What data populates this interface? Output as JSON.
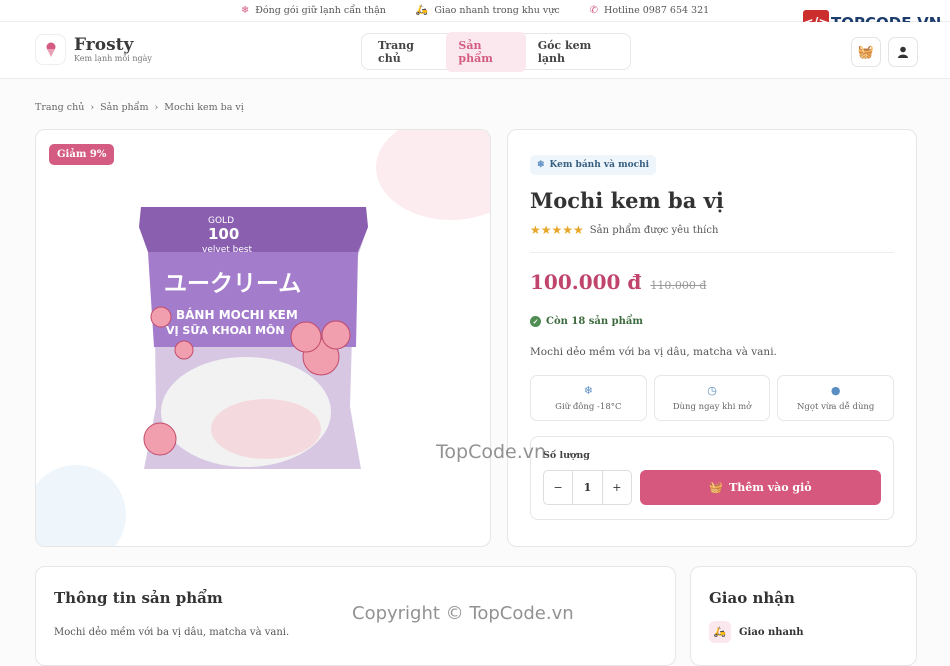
{
  "topbar": {
    "item1": "Đóng gói giữ lạnh cẩn thận",
    "item2": "Giao nhanh trong khu vực",
    "item3": "Hotline 0987 654 321"
  },
  "watermark_logo": "TOPCODE.VN",
  "brand": {
    "name": "Frosty",
    "tagline": "Kem lạnh mỗi ngày"
  },
  "nav": {
    "home": "Trang chủ",
    "products": "Sản phẩm",
    "corner": "Góc kem lạnh"
  },
  "breadcrumb": {
    "home": "Trang chủ",
    "products": "Sản phẩm",
    "current": "Mochi kem ba vị"
  },
  "product": {
    "discount_badge": "Giảm 9%",
    "category": "Kem bánh và mochi",
    "title": "Mochi kem ba vị",
    "rating_label": "Sản phẩm được yêu thích",
    "rating_stars": 5,
    "price": "100.000 đ",
    "old_price": "110.000 đ",
    "stock": "Còn 18 sản phẩm",
    "description": "Mochi dẻo mềm với ba vị dâu, matcha và vani.",
    "features": [
      "Giữ đông -18°C",
      "Dùng ngay khi mở",
      "Ngọt vừa dễ dùng"
    ],
    "qty_label": "Số lượng",
    "qty_value": "1",
    "add_to_cart": "Thêm vào giỏ"
  },
  "package": {
    "brand_top": "GOLD",
    "brand_num": "100",
    "brand_sub": "velvet best",
    "jp_text": "ユークリーム",
    "line1": "BÁNH MOCHI KEM",
    "line2": "VỊ SỮA KHOAI MÔN"
  },
  "info_section": {
    "title": "Thông tin sản phẩm",
    "description": "Mochi dẻo mềm với ba vị dâu, matcha và vani."
  },
  "shipping_section": {
    "title": "Giao nhận",
    "item1": "Giao nhanh"
  },
  "watermarks": {
    "center": "TopCode.vn",
    "copyright": "Copyright © TopCode.vn"
  },
  "colors": {
    "accent": "#d6587f",
    "price": "#c0446c",
    "stock": "#4f8d52"
  }
}
